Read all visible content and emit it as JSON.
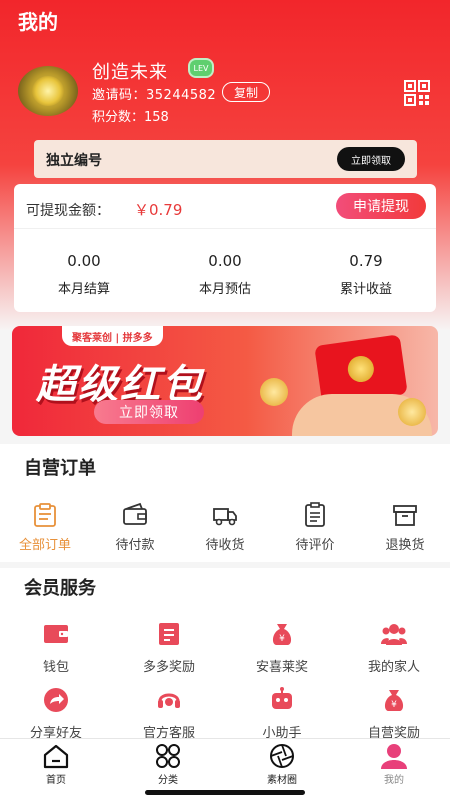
{
  "header": {
    "title": "我的",
    "username": "创造未来",
    "level_badge": "LEV",
    "invite_text": "邀请码：35244582",
    "copy_label": "复制",
    "points_text": "积分数：158"
  },
  "id_bar": {
    "label": "独立编号",
    "button": "立即领取"
  },
  "wallet": {
    "withdraw_label": "可提现金额：",
    "withdraw_amount": "￥0.79",
    "withdraw_button": "申请提现",
    "stats": [
      {
        "value": "0.00",
        "label": "本月结算"
      },
      {
        "value": "0.00",
        "label": "本月预估"
      },
      {
        "value": "0.79",
        "label": "累计收益"
      }
    ]
  },
  "banner": {
    "brands": "聚客莱创 | 拼多多",
    "title": "超级红包",
    "button": "立即领取"
  },
  "orders": {
    "title": "自营订单",
    "items": [
      {
        "label": "全部订单",
        "icon": "clipboard-icon"
      },
      {
        "label": "待付款",
        "icon": "wallet-icon"
      },
      {
        "label": "待收货",
        "icon": "truck-icon"
      },
      {
        "label": "待评价",
        "icon": "document-icon"
      },
      {
        "label": "退换货",
        "icon": "box-icon"
      }
    ]
  },
  "services": {
    "title": "会员服务",
    "items": [
      {
        "label": "钱包",
        "icon": "wallet-icon"
      },
      {
        "label": "多多奖励",
        "icon": "document-icon"
      },
      {
        "label": "安喜莱奖",
        "icon": "money-bag-icon"
      },
      {
        "label": "我的家人",
        "icon": "family-icon"
      },
      {
        "label": "分享好友",
        "icon": "share-icon"
      },
      {
        "label": "官方客服",
        "icon": "headset-icon"
      },
      {
        "label": "小助手",
        "icon": "robot-icon"
      },
      {
        "label": "自营奖励",
        "icon": "money-bag-icon"
      }
    ]
  },
  "tabbar": {
    "items": [
      {
        "label": "首页",
        "icon": "home-icon"
      },
      {
        "label": "分类",
        "icon": "category-icon"
      },
      {
        "label": "素材圈",
        "icon": "aperture-icon"
      },
      {
        "label": "我的",
        "icon": "profile-icon"
      }
    ]
  },
  "colors": {
    "primary_red": "#f2262b",
    "accent_pink": "#f24d7a",
    "active_tab": "#e8407a"
  }
}
